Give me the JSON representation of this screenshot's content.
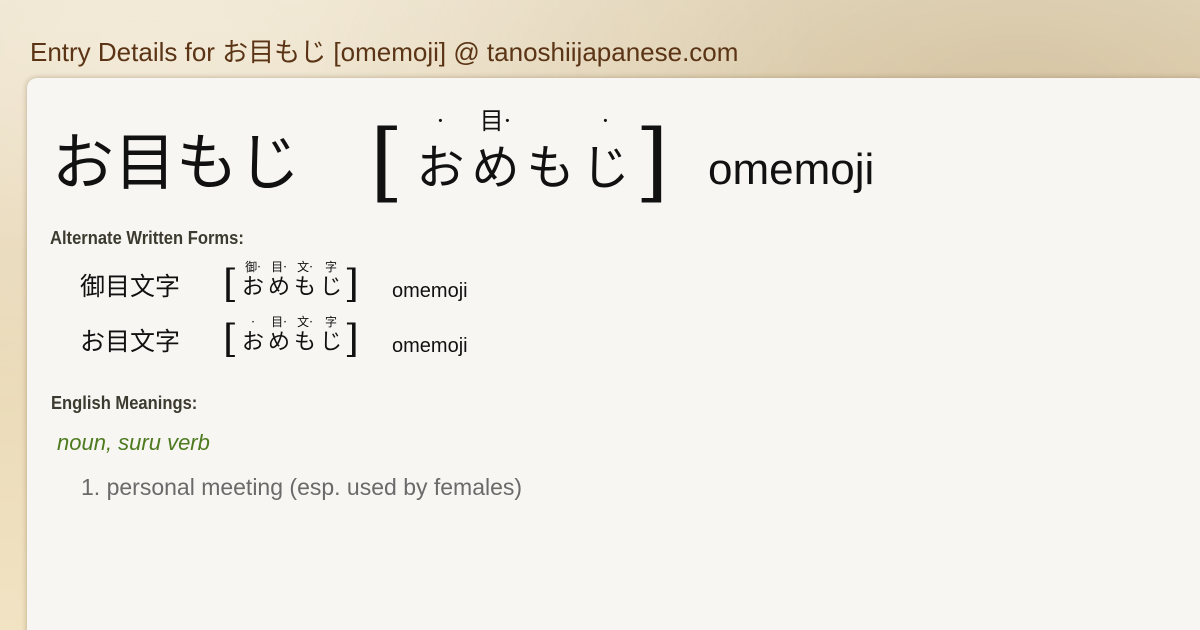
{
  "site": {
    "title": "Entry Details for お目もじ [omemoji] @ tanoshiijapanese.com"
  },
  "headword": {
    "written": "お目もじ",
    "bracket_open": "[",
    "bracket_close": "]",
    "kana": [
      "お",
      "め",
      "も",
      "じ"
    ],
    "ruby": [
      "·",
      "目·",
      "",
      "·"
    ],
    "romaji": "omemoji"
  },
  "alternate_forms": {
    "label": "Alternate Written Forms:",
    "items": [
      {
        "written": "御目文字",
        "kana": [
          "お",
          "め",
          "も",
          "じ"
        ],
        "ruby": [
          "御·",
          "目·",
          "文·",
          "字"
        ],
        "romaji": "omemoji"
      },
      {
        "written": "お目文字",
        "kana": [
          "お",
          "め",
          "も",
          "じ"
        ],
        "ruby": [
          "·",
          "目·",
          "文·",
          "字"
        ],
        "romaji": "omemoji"
      }
    ]
  },
  "meanings": {
    "label": "English Meanings:",
    "part_of_speech": "noun, suru verb",
    "definitions": [
      "1. personal meeting (esp. used by females)"
    ]
  },
  "colors": {
    "site_title": "#5a3415",
    "part_of_speech": "#4d7a1f",
    "definition": "#6a6a6a",
    "card_background": "#f7f6f2"
  }
}
